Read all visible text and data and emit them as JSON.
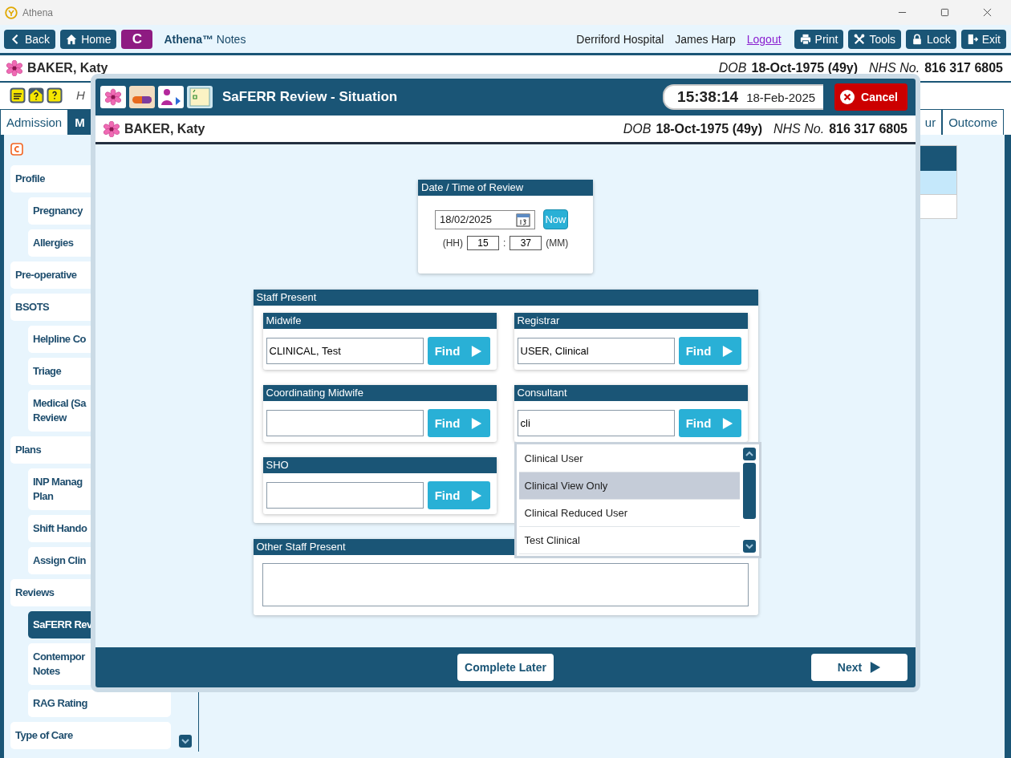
{
  "window": {
    "title": "Athena"
  },
  "toolbar": {
    "back": "Back",
    "home": "Home",
    "badge": "C",
    "app_title": "**Athena™** Notes",
    "location": "Derriford Hospital",
    "user": "James Harp",
    "logout": "Logout",
    "actions": [
      {
        "label": "Print"
      },
      {
        "label": "Tools"
      },
      {
        "label": "Lock"
      },
      {
        "label": "Exit"
      }
    ]
  },
  "patient": {
    "name": "BAKER, Katy",
    "dob_label": "DOB",
    "dob": "18-Oct-1975 (49y)",
    "nhs_label": "NHS No.",
    "nhs": "816 317 6805"
  },
  "hint": "H",
  "tabs_left": [
    {
      "label": "Admission",
      "selected": false
    },
    {
      "label": "M",
      "selected": true
    }
  ],
  "tabs_right": [
    {
      "label": "ur",
      "selected": false
    },
    {
      "label": "Outcome",
      "selected": false
    }
  ],
  "sidebar": {
    "items": [
      {
        "label": "Profile",
        "selected": false,
        "children": [
          {
            "label": "Pregnancy",
            "selected": false
          },
          {
            "label": "Allergies",
            "selected": false
          }
        ]
      },
      {
        "label": "Pre-operative",
        "selected": false
      },
      {
        "label": "BSOTS",
        "selected": false,
        "children": [
          {
            "label": "Helpline Co",
            "selected": false
          },
          {
            "label": "Triage",
            "selected": false
          },
          {
            "label": "Medical (Sa\nReview",
            "selected": false
          }
        ]
      },
      {
        "label": "Plans",
        "selected": false,
        "children": [
          {
            "label": "INP Manag\nPlan",
            "selected": false
          },
          {
            "label": "Shift Hando",
            "selected": false
          },
          {
            "label": "Assign Clin",
            "selected": false
          }
        ]
      },
      {
        "label": "Reviews",
        "selected": false,
        "children": [
          {
            "label": "SaFERR Rev",
            "selected": true
          },
          {
            "label": "Contempor\nNotes",
            "selected": false
          },
          {
            "label": "RAG Rating",
            "selected": false
          }
        ]
      },
      {
        "label": "Type of Care",
        "selected": false
      }
    ]
  },
  "dialog": {
    "title": "SaFERR Review - Situation",
    "time": "15:38:14",
    "date": "18-Feb-2025",
    "cancel": "Cancel",
    "patient": {
      "name": "BAKER, Katy",
      "dob_label": "DOB",
      "dob": "18-Oct-1975 (49y)",
      "nhs_label": "NHS No.",
      "nhs": "816 317 6805"
    },
    "review_time": {
      "title": "Date / Time of Review",
      "date": "18/02/2025",
      "now": "Now",
      "hh_label": "(HH)",
      "hh": "15",
      "separator": ":",
      "mm": "37",
      "mm_label": "(MM)"
    },
    "staff": {
      "title": "Staff Present",
      "roles": [
        {
          "title": "Midwife",
          "value": "CLINICAL, Test",
          "find": "Find"
        },
        {
          "title": "Registrar",
          "value": "USER, Clinical",
          "find": "Find"
        },
        {
          "title": "Coordinating Midwife",
          "find": "Find"
        },
        {
          "title": "Consultant",
          "value": "cli",
          "find": "Find",
          "suggestions": [
            {
              "label": "Clinical User",
              "selected": false
            },
            {
              "label": "Clinical View Only",
              "selected": true
            },
            {
              "label": "Clinical Reduced User",
              "selected": false
            },
            {
              "label": "Test Clinical",
              "selected": false
            }
          ]
        },
        {
          "title": "SHO",
          "find": "Find"
        }
      ]
    },
    "other_staff": {
      "title": "Other Staff Present"
    },
    "complete_later": "Complete Later",
    "next": "Next"
  }
}
